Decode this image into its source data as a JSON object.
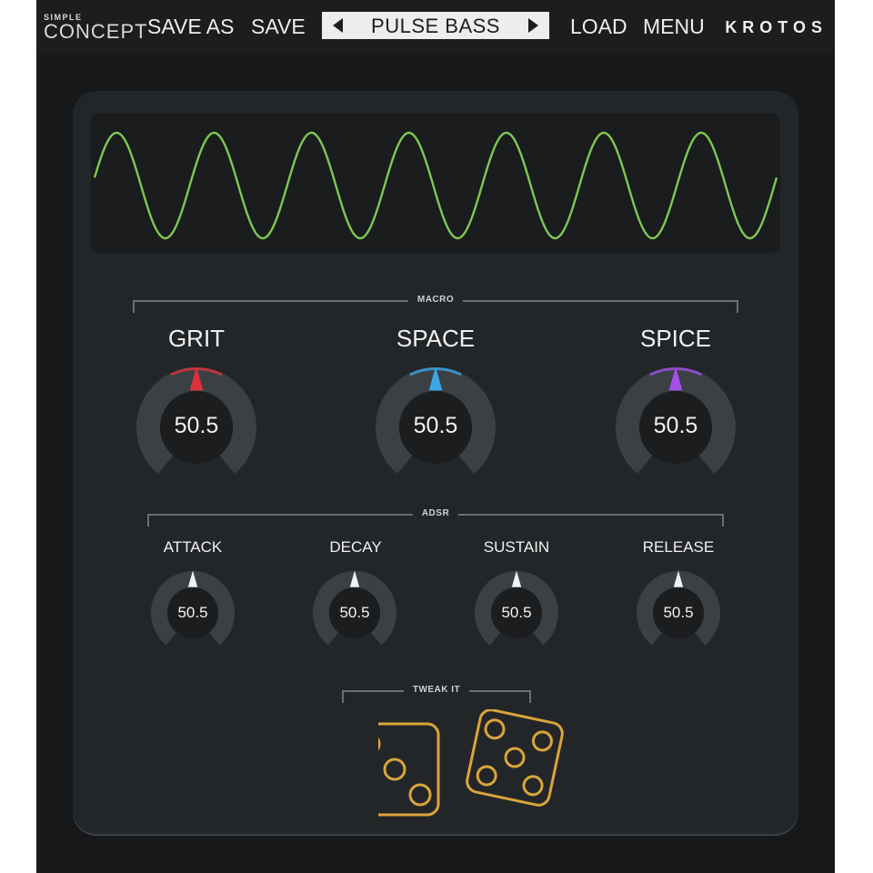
{
  "app": {
    "logo_small": "SIMPLE",
    "logo_big": "CONCEPT",
    "brand": "KROTOS"
  },
  "toolbar": {
    "save_as": "SAVE AS",
    "save": "SAVE",
    "preset_name": "PULSE BASS",
    "load": "LOAD",
    "menu": "MENU",
    "prev_icon": "triangle-left-icon",
    "next_icon": "triangle-right-icon"
  },
  "oscilloscope": {
    "wave_color": "#7ec850",
    "cycles": 7
  },
  "macro": {
    "section_label": "MACRO",
    "knobs": [
      {
        "name": "GRIT",
        "value": "50.5",
        "level": 0.5,
        "color": "#e0313a"
      },
      {
        "name": "SPACE",
        "value": "50.5",
        "level": 0.5,
        "color": "#3aa6e6"
      },
      {
        "name": "SPICE",
        "value": "50.5",
        "level": 0.5,
        "color": "#a64ee8"
      }
    ]
  },
  "adsr": {
    "section_label": "ADSR",
    "knobs": [
      {
        "name": "ATTACK",
        "value": "50.5",
        "level": 0.5
      },
      {
        "name": "DECAY",
        "value": "50.5",
        "level": 0.5
      },
      {
        "name": "SUSTAIN",
        "value": "50.5",
        "level": 0.5
      },
      {
        "name": "RELEASE",
        "value": "50.5",
        "level": 0.5
      }
    ]
  },
  "tweak": {
    "section_label": "TWEAK IT",
    "icon": "dice-icon",
    "color": "#d9a53a"
  }
}
